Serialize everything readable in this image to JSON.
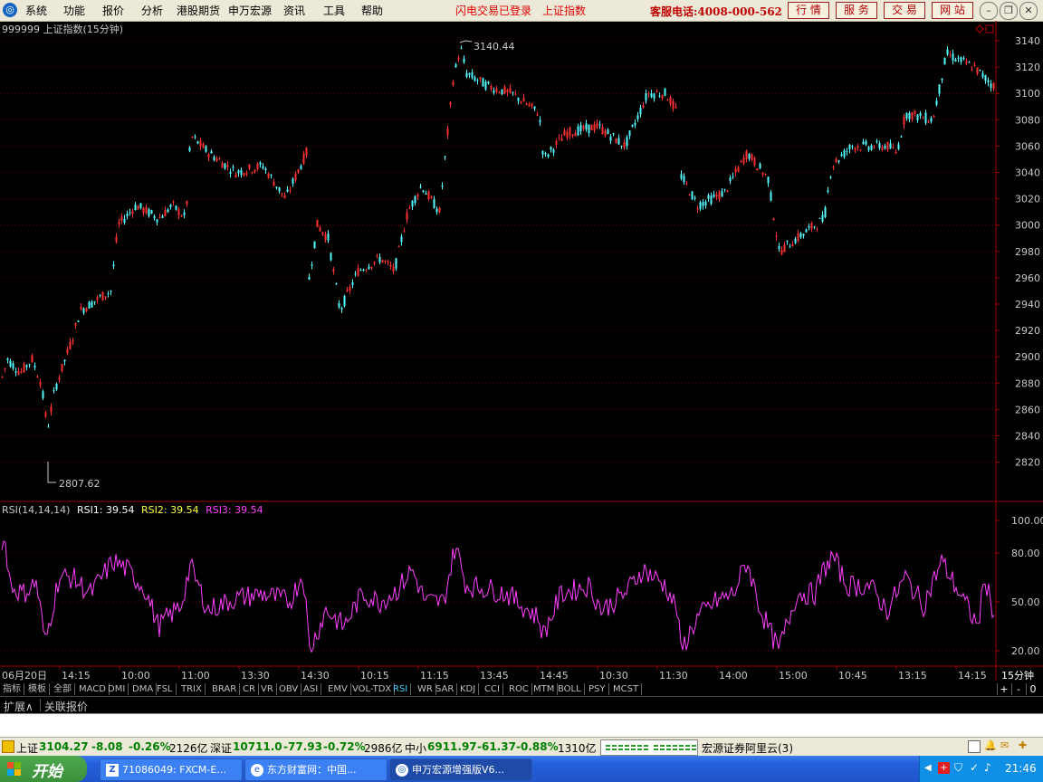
{
  "menubar": {
    "items": [
      "系统",
      "功能",
      "报价",
      "分析",
      "港股期货",
      "申万宏源",
      "资讯",
      "工具",
      "帮助"
    ],
    "status1": "闪电交易已登录",
    "status2": "上证指数",
    "hotline": "客服电话:4008-000-562",
    "buttons": [
      "行 情",
      "服 务",
      "交 易",
      "网 站"
    ],
    "window_controls": [
      "minimize-icon",
      "restore-icon",
      "close-icon"
    ]
  },
  "main_chart": {
    "title": "999999 上证指数(15分钟)",
    "high_label": "3140.44",
    "low_label": "2807.62",
    "y_ticks": [
      3140,
      3120,
      3100,
      3080,
      3060,
      3040,
      3020,
      3000,
      2980,
      2960,
      2940,
      2920,
      2900,
      2880,
      2860,
      2840,
      2820
    ]
  },
  "rsi_chart": {
    "label_name": "RSI(14,14,14)",
    "rsi1": "RSI1: 39.54",
    "rsi2": "RSI2: 39.54",
    "rsi3": "RSI3: 39.54",
    "y_ticks": [
      "100.00",
      "80.00",
      "50.00",
      "20.00"
    ]
  },
  "time_axis": {
    "labels": [
      "06月20日",
      "14:15",
      "10:00",
      "11:00",
      "13:30",
      "14:30",
      "10:15",
      "11:15",
      "13:45",
      "14:45",
      "10:30",
      "11:30",
      "14:00",
      "15:00",
      "10:45",
      "13:15",
      "14:15"
    ],
    "period": "15分钟"
  },
  "indicator_tabs": [
    "指标",
    "模板",
    "全部",
    "MACD",
    "DMI",
    "DMA",
    "FSL",
    "TRIX",
    "BRAR",
    "CR",
    "VR",
    "OBV",
    "ASI",
    "EMV",
    "VOL-TDX",
    "RSI",
    "WR",
    "SAR",
    "KDJ",
    "CCI",
    "ROC",
    "MTM",
    "BOLL",
    "PSY",
    "MCST"
  ],
  "active_tab": "RSI",
  "tab_controls": [
    "+",
    "-",
    "0"
  ],
  "ext_bar": {
    "expand": "扩展∧",
    "related": "关联报价"
  },
  "quote_bar": {
    "sh_name": "上证",
    "sh_value": "3104.27",
    "sh_change": "-8.08",
    "sh_pct": "-0.26%",
    "sh_amount": "2126亿",
    "sz_name": "深证",
    "sz_value": "10711.0",
    "sz_change": "-77.93",
    "sz_pct": "-0.72%",
    "sz_amount": "2986亿",
    "zx_name": "中小",
    "zx_value": "6911.97",
    "zx_change": "-61.37",
    "zx_pct": "-0.88%",
    "zx_amount": "1310亿",
    "server": "宏源证券阿里云(3)"
  },
  "taskbar": {
    "start": "开始",
    "tasks": [
      "71086049: FXCM-E...",
      "东方财富网：中国...",
      "申万宏源增强版V6..."
    ],
    "clock": "21:46"
  },
  "colors": {
    "up": "#ff3030",
    "down": "#54ffff",
    "rsi": "#ff40ff",
    "axis": "#a00000",
    "tick_text": "#c8c8c8",
    "quote_down": "#008000",
    "status_red": "#e00000"
  }
}
